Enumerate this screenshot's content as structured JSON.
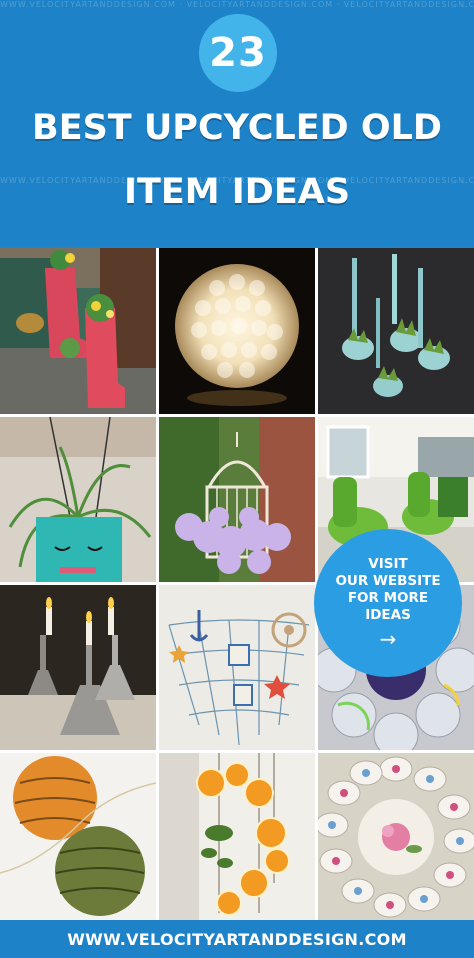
{
  "header": {
    "count": "23",
    "title_line1": "BEST UPCYCLED OLD",
    "title_line2": "ITEM IDEAS",
    "watermark": "WWW.VELOCITYARTANDDESIGN.COM · VELOCITYARTANDDESIGN.COM · VELOCITYARTANDDESIGN.COM · VELOCITYARTANDDESIGN.COM"
  },
  "visit": {
    "line1": "VISIT",
    "line2": "OUR WEBSITE",
    "line3": "FOR MORE",
    "line4": "IDEAS",
    "arrow": "→"
  },
  "footer": {
    "url": "WWW.VELOCITYARTANDDESIGN.COM"
  },
  "colors": {
    "brand_blue": "#1d82c7",
    "circle_blue": "#43b4ea",
    "visit_blue": "#2b9de2"
  }
}
